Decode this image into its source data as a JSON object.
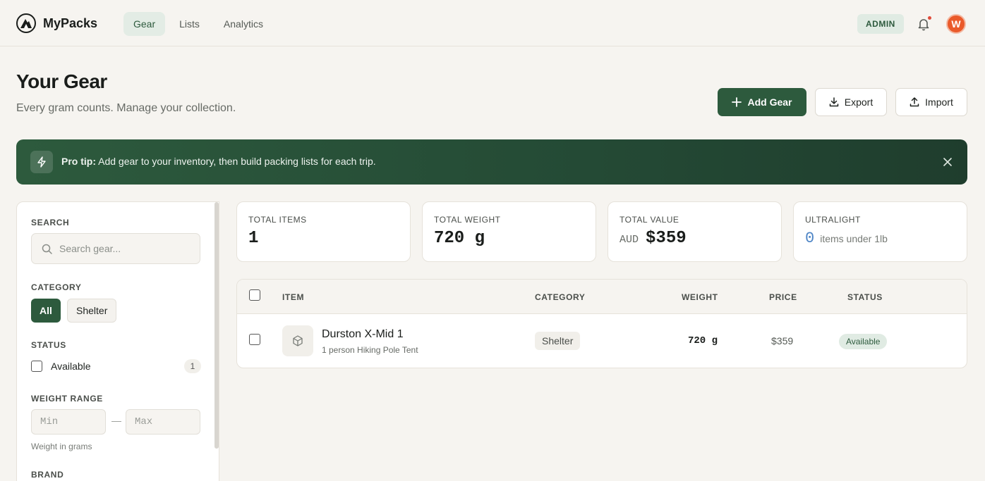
{
  "app": {
    "name": "MyPacks",
    "logo_icon": "mountain-logo-icon",
    "nav": [
      {
        "label": "Gear",
        "active": true
      },
      {
        "label": "Lists",
        "active": false
      },
      {
        "label": "Analytics",
        "active": false
      }
    ],
    "admin_badge": "ADMIN",
    "notification_icon": "bell-icon",
    "avatar_initial": "W"
  },
  "page": {
    "title": "Your Gear",
    "subtitle": "Every gram counts. Manage your collection.",
    "actions": {
      "add": {
        "label": "Add Gear",
        "icon": "plus-icon"
      },
      "export": {
        "label": "Export",
        "icon": "download-icon"
      },
      "import": {
        "label": "Import",
        "icon": "upload-icon"
      }
    }
  },
  "tip": {
    "icon": "lightning-icon",
    "bold": "Pro tip:",
    "text": " Add gear to your inventory, then build packing lists for each trip.",
    "close_icon": "close-icon"
  },
  "filters": {
    "search": {
      "label": "SEARCH",
      "placeholder": "Search gear...",
      "value": ""
    },
    "category": {
      "label": "CATEGORY",
      "options": [
        "All",
        "Shelter"
      ],
      "selected": "All"
    },
    "status": {
      "label": "STATUS",
      "options": [
        {
          "label": "Available",
          "count": "1",
          "checked": false
        }
      ]
    },
    "weight_range": {
      "label": "WEIGHT RANGE",
      "min_placeholder": "Min",
      "max_placeholder": "Max",
      "separator": "—",
      "help": "Weight in grams"
    },
    "brand": {
      "label": "BRAND"
    }
  },
  "stats": {
    "total_items": {
      "label": "TOTAL ITEMS",
      "value": "1"
    },
    "total_weight": {
      "label": "TOTAL WEIGHT",
      "value": "720 g"
    },
    "total_value": {
      "label": "TOTAL VALUE",
      "currency": "AUD",
      "value": "$359"
    },
    "ultralight": {
      "label": "ULTRALIGHT",
      "value": "0",
      "text": "items under 1lb"
    }
  },
  "table": {
    "columns": [
      "ITEM",
      "CATEGORY",
      "WEIGHT",
      "PRICE",
      "STATUS"
    ],
    "rows": [
      {
        "name": "Durston X-Mid 1",
        "description": "1 person Hiking Pole Tent",
        "icon": "package-icon",
        "category": "Shelter",
        "weight": "720 g",
        "price": "$359",
        "status": "Available"
      }
    ]
  },
  "colors": {
    "accent": "#2d5a3d",
    "background": "#f6f4f0",
    "avatar": "#ea5a2a",
    "ultralight_number": "#4f86c6"
  }
}
